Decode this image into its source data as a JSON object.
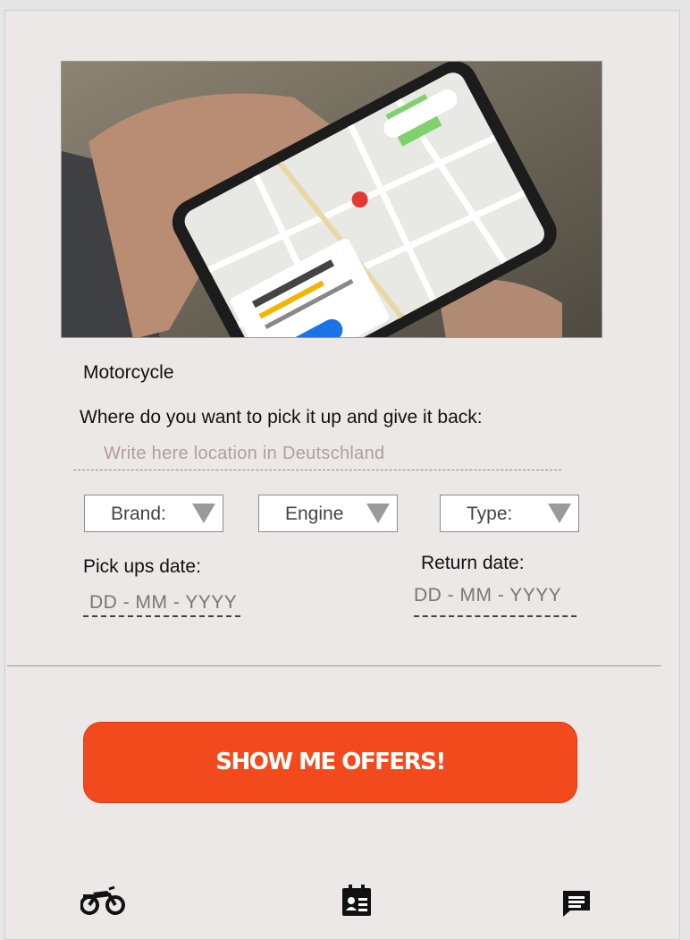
{
  "hero_image": {
    "description_icon": "phone-map-icon"
  },
  "vehicle_type": "Motorcycle",
  "location": {
    "question": "Where do you want to pick it up and give it back:",
    "placeholder": "Write here location in Deutschland"
  },
  "filters": {
    "brand_label": "Brand:",
    "engine_label": "Engine",
    "type_label": "Type:"
  },
  "dates": {
    "pickup_label": "Pick ups date:",
    "pickup_placeholder": "DD - MM - YYYY",
    "return_label": "Return date:",
    "return_placeholder": "DD - MM - YYYY"
  },
  "cta": {
    "label": "SHOW ME OFFERS!"
  },
  "colors": {
    "accent": "#f24a1c",
    "background": "#ebe8e7"
  },
  "bottom_nav": {
    "items": [
      {
        "icon": "motorcycle-icon"
      },
      {
        "icon": "id-card-icon"
      },
      {
        "icon": "chat-icon"
      }
    ]
  }
}
